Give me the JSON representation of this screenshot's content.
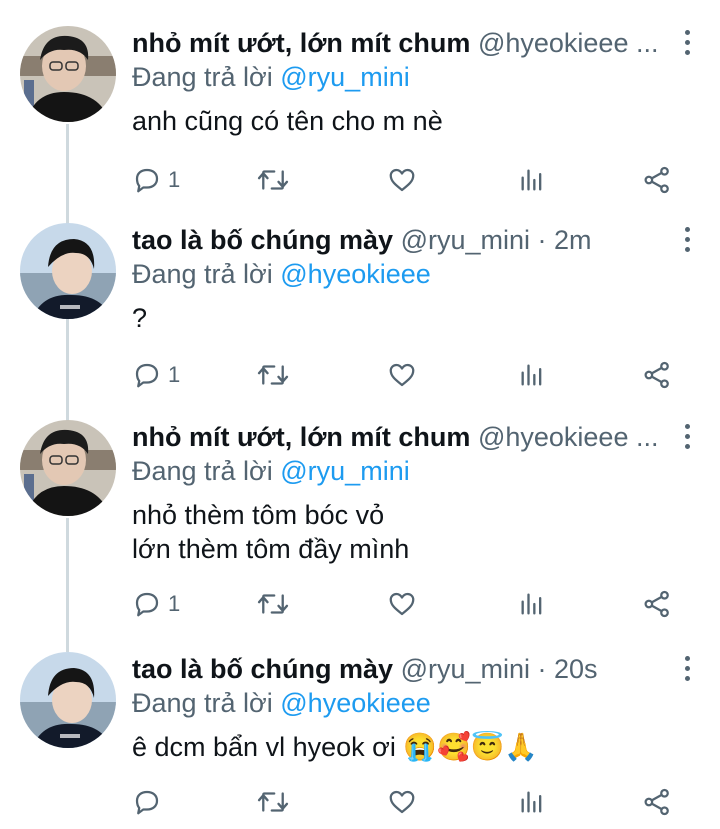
{
  "tweets": [
    {
      "name": "nhỏ mít ướt, lớn mít chum",
      "handle": "@hyeokieee ...",
      "reply_prefix": "Đang trả lời ",
      "reply_to": "@ryu_mini",
      "lines": [
        "anh cũng có tên cho m nè"
      ],
      "reply_count": "1",
      "avatar": "hyeokieee"
    },
    {
      "name": "tao là bố chúng mày",
      "handle": "@ryu_mini · 2m",
      "reply_prefix": "Đang trả lời ",
      "reply_to": "@hyeokieee",
      "lines": [
        "?"
      ],
      "reply_count": "1",
      "avatar": "ryu_mini"
    },
    {
      "name": "nhỏ mít ướt, lớn mít chum",
      "handle": "@hyeokieee ...",
      "reply_prefix": "Đang trả lời ",
      "reply_to": "@ryu_mini",
      "lines": [
        "nhỏ thèm tôm bóc vỏ",
        "lớn thèm tôm đầy mình"
      ],
      "reply_count": "1",
      "avatar": "hyeokieee"
    },
    {
      "name": "tao là bố chúng mày",
      "handle": "@ryu_mini · 20s",
      "reply_prefix": "Đang trả lời ",
      "reply_to": "@hyeokieee",
      "lines": [
        "ê dcm bẩn vl hyeok ơi "
      ],
      "emojis": "😭🥰😇🙏",
      "reply_count": "",
      "avatar": "ryu_mini"
    }
  ],
  "colors": {
    "accent": "#1d9bf0",
    "secondary": "#536471",
    "thread_line": "#cfd9de"
  },
  "icons": [
    "reply-icon",
    "retweet-icon",
    "like-icon",
    "analytics-icon",
    "share-icon",
    "more-icon"
  ]
}
